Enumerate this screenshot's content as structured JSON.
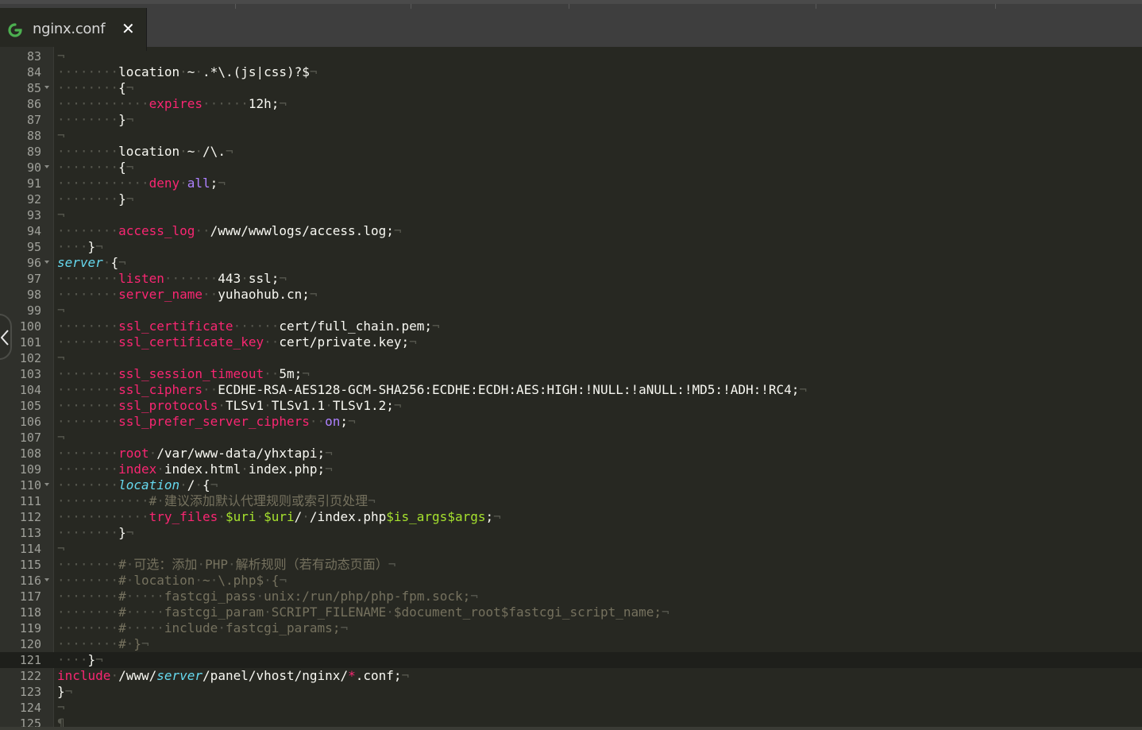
{
  "tab": {
    "title": "nginx.conf",
    "close": "✕"
  },
  "editor": {
    "active_line": 121,
    "lines": [
      {
        "n": "83",
        "fold": false,
        "t": "¬"
      },
      {
        "n": "84",
        "fold": false,
        "t": "········location·~·.*\\.(js|css)?$¬"
      },
      {
        "n": "85",
        "fold": true,
        "t": "········{¬"
      },
      {
        "n": "86",
        "fold": false,
        "t": "············expires······12h;¬"
      },
      {
        "n": "87",
        "fold": false,
        "t": "········}¬"
      },
      {
        "n": "88",
        "fold": false,
        "t": "¬"
      },
      {
        "n": "89",
        "fold": false,
        "t": "········location·~·/\\.¬"
      },
      {
        "n": "90",
        "fold": true,
        "t": "········{¬"
      },
      {
        "n": "91",
        "fold": false,
        "t": "············deny·all;¬"
      },
      {
        "n": "92",
        "fold": false,
        "t": "········}¬"
      },
      {
        "n": "93",
        "fold": false,
        "t": "¬"
      },
      {
        "n": "94",
        "fold": false,
        "t": "········access_log··/www/wwwlogs/access.log;¬"
      },
      {
        "n": "95",
        "fold": false,
        "t": "····}¬"
      },
      {
        "n": "96",
        "fold": true,
        "t": "server·{¬"
      },
      {
        "n": "97",
        "fold": false,
        "t": "········listen·······443·ssl;¬"
      },
      {
        "n": "98",
        "fold": false,
        "t": "········server_name··yuhaohub.cn;¬"
      },
      {
        "n": "99",
        "fold": false,
        "t": "¬"
      },
      {
        "n": "100",
        "fold": false,
        "t": "········ssl_certificate······cert/full_chain.pem;¬"
      },
      {
        "n": "101",
        "fold": false,
        "t": "········ssl_certificate_key··cert/private.key;¬"
      },
      {
        "n": "102",
        "fold": false,
        "t": "¬"
      },
      {
        "n": "103",
        "fold": false,
        "t": "········ssl_session_timeout··5m;¬"
      },
      {
        "n": "104",
        "fold": false,
        "t": "········ssl_ciphers··ECDHE-RSA-AES128-GCM-SHA256:ECDHE:ECDH:AES:HIGH:!NULL:!aNULL:!MD5:!ADH:!RC4;¬"
      },
      {
        "n": "105",
        "fold": false,
        "t": "········ssl_protocols·TLSv1·TLSv1.1·TLSv1.2;¬"
      },
      {
        "n": "106",
        "fold": false,
        "t": "········ssl_prefer_server_ciphers··on;¬"
      },
      {
        "n": "107",
        "fold": false,
        "t": "¬"
      },
      {
        "n": "108",
        "fold": false,
        "t": "········root·/var/www-data/yhxtapi;¬"
      },
      {
        "n": "109",
        "fold": false,
        "t": "········index·index.html·index.php;¬"
      },
      {
        "n": "110",
        "fold": true,
        "t": "········location·/·{¬"
      },
      {
        "n": "111",
        "fold": false,
        "t": "············#·建议添加默认代理规则或索引页处理¬"
      },
      {
        "n": "112",
        "fold": false,
        "t": "············try_files·$uri·$uri/·/index.php$is_args$args;¬"
      },
      {
        "n": "113",
        "fold": false,
        "t": "········}¬"
      },
      {
        "n": "114",
        "fold": false,
        "t": "¬"
      },
      {
        "n": "115",
        "fold": false,
        "t": "········#·可选：添加·PHP·解析规则（若有动态页面）¬"
      },
      {
        "n": "116",
        "fold": true,
        "t": "········#·location·~·\\.php$·{¬"
      },
      {
        "n": "117",
        "fold": false,
        "t": "········#·····fastcgi_pass·unix:/run/php/php-fpm.sock;¬"
      },
      {
        "n": "118",
        "fold": false,
        "t": "········#·····fastcgi_param·SCRIPT_FILENAME·$document_root$fastcgi_script_name;¬"
      },
      {
        "n": "119",
        "fold": false,
        "t": "········#·····include·fastcgi_params;¬"
      },
      {
        "n": "120",
        "fold": false,
        "t": "········#·}¬"
      },
      {
        "n": "121",
        "fold": false,
        "t": "····}¬"
      },
      {
        "n": "122",
        "fold": false,
        "t": "include·/www/server/panel/vhost/nginx/*.conf;¬"
      },
      {
        "n": "123",
        "fold": false,
        "t": "}¬"
      },
      {
        "n": "124",
        "fold": false,
        "t": "¬"
      },
      {
        "n": "125",
        "fold": false,
        "t": "¶"
      }
    ]
  },
  "theme": {
    "background": "#272822",
    "keyword": "#f92672",
    "variable": "#a6e22e",
    "comment": "#75715e"
  },
  "icons": {
    "tab_icon": "sublime-file-icon",
    "side_toggle": "chevron-left-icon"
  }
}
